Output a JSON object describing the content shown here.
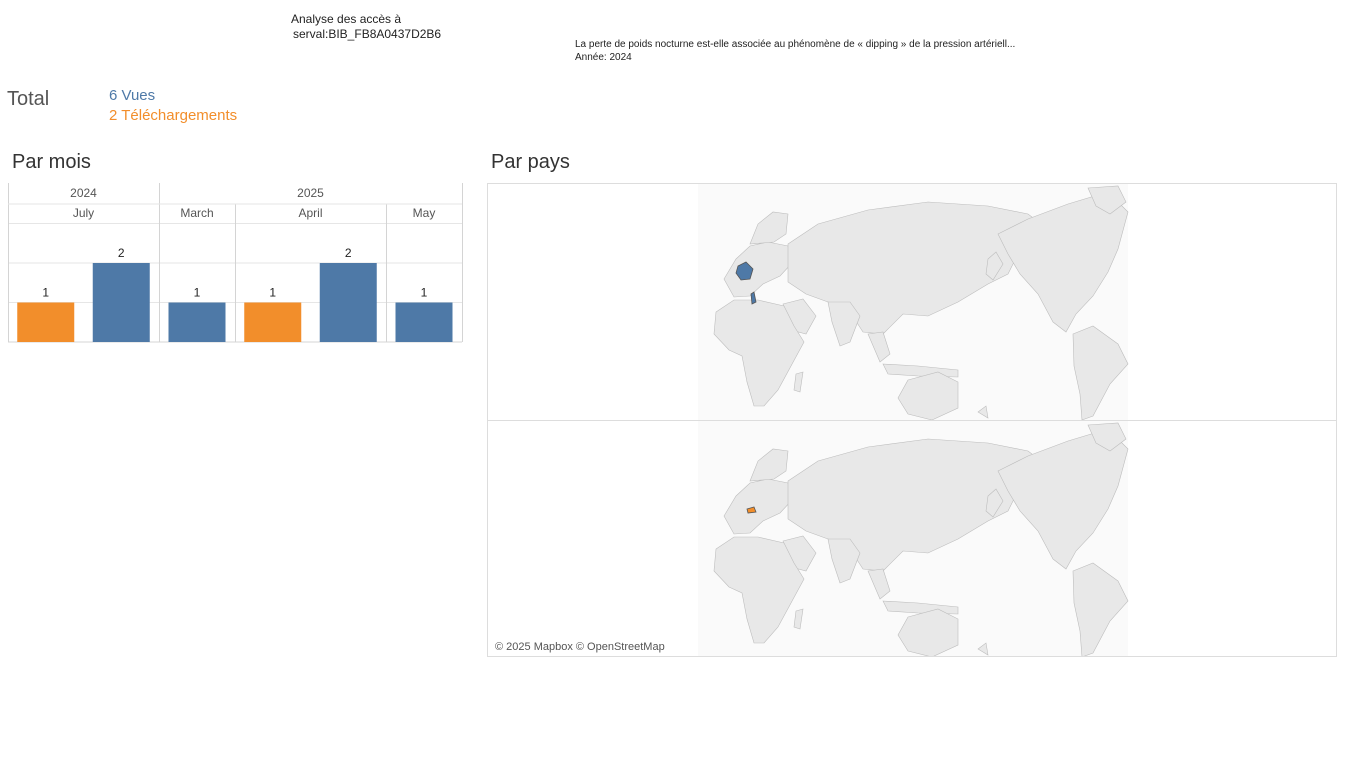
{
  "header": {
    "title": "Analyse des accès à",
    "identifier": "serval:BIB_FB8A0437D2B6"
  },
  "document": {
    "title": "La perte de poids nocturne est-elle associée au phénomène de « dipping » de la pression artériell...",
    "year": "Année: 2024"
  },
  "totals": {
    "label": "Total",
    "views": "6 Vues",
    "downloads": "2 Téléchargements"
  },
  "sections": {
    "by_month": "Par mois",
    "by_country": "Par pays"
  },
  "map": {
    "credit": "© 2025 Mapbox © OpenStreetMap"
  },
  "colors": {
    "views": "#4e79a7",
    "downloads": "#f28e2b",
    "land": "#e8e8e8",
    "border": "#bdbdbd"
  },
  "chart_data": [
    {
      "type": "bar",
      "title": "Par mois",
      "years": [
        {
          "label": "2024",
          "months": [
            "July"
          ]
        },
        {
          "label": "2025",
          "months": [
            "March",
            "April",
            "May"
          ]
        }
      ],
      "categories": [
        "July",
        "March",
        "April",
        "May"
      ],
      "series": [
        {
          "key": "downloads",
          "values": [
            1,
            null,
            1,
            null
          ]
        },
        {
          "key": "views",
          "values": [
            2,
            1,
            2,
            1
          ]
        }
      ],
      "ylim": [
        0,
        3
      ]
    },
    {
      "type": "map",
      "title": "Par pays",
      "panels": [
        {
          "key": "views",
          "countries": [
            "France",
            "Tunisia"
          ]
        },
        {
          "key": "downloads",
          "countries": [
            "Switzerland"
          ]
        }
      ]
    }
  ]
}
